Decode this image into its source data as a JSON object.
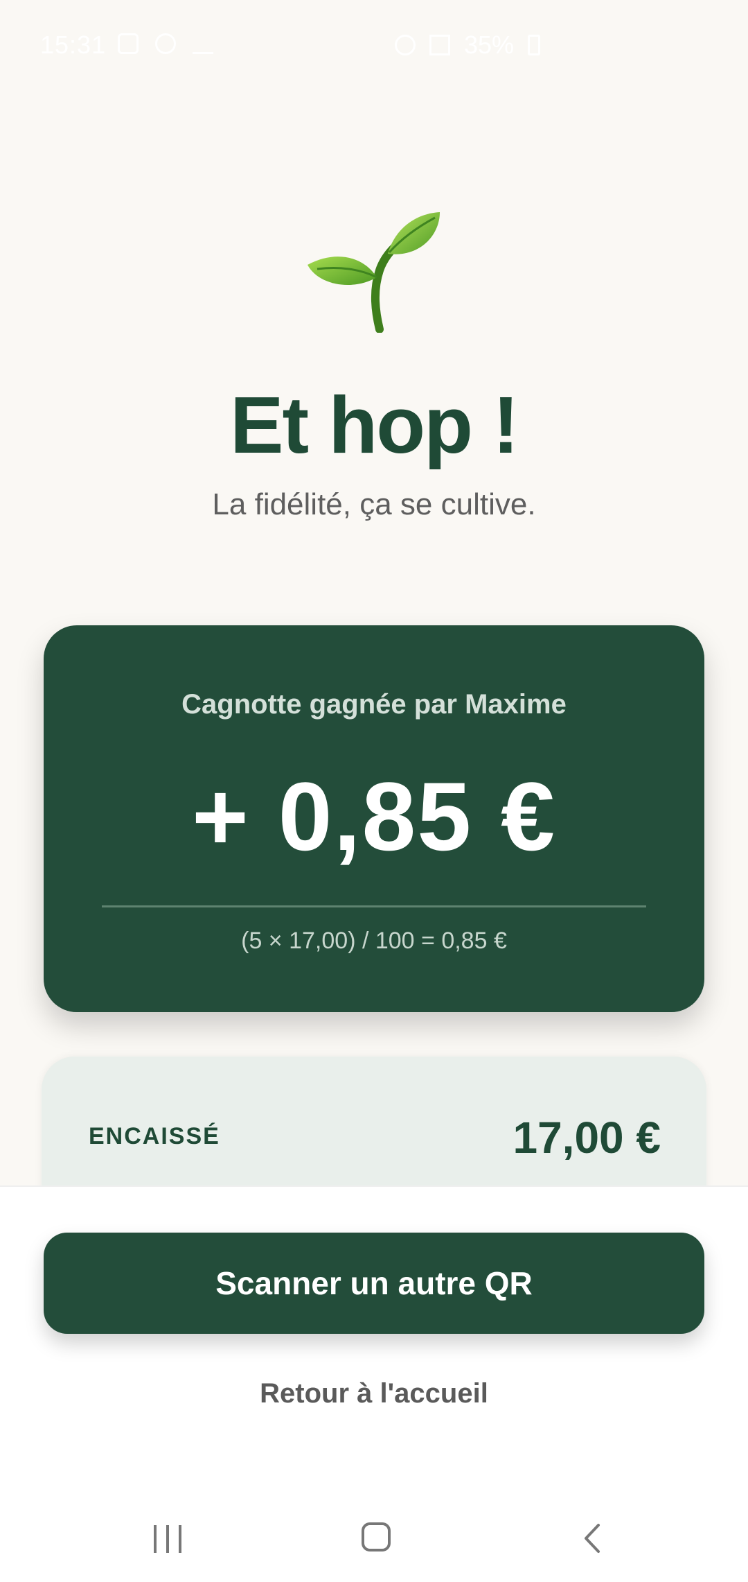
{
  "status_bar": {
    "time": "15:31",
    "battery": "35%"
  },
  "hero": {
    "icon": "seedling-icon",
    "title": "Et hop !",
    "subtitle": "La fidélité, ça se cultive."
  },
  "reward": {
    "label": "Cagnotte gagnée par Maxime",
    "amount": "+ 0,85 €",
    "formula": "(5 × 17,00) / 100 = 0,85 €"
  },
  "cashed": {
    "label": "ENCAISSÉ",
    "value": "17,00 €"
  },
  "actions": {
    "scan_label": "Scanner un autre QR",
    "home_label": "Retour à l'accueil"
  },
  "colors": {
    "primary": "#234D3A",
    "title": "#1F4A36",
    "background": "#FAF8F4",
    "card_light": "#E9EFEB"
  }
}
